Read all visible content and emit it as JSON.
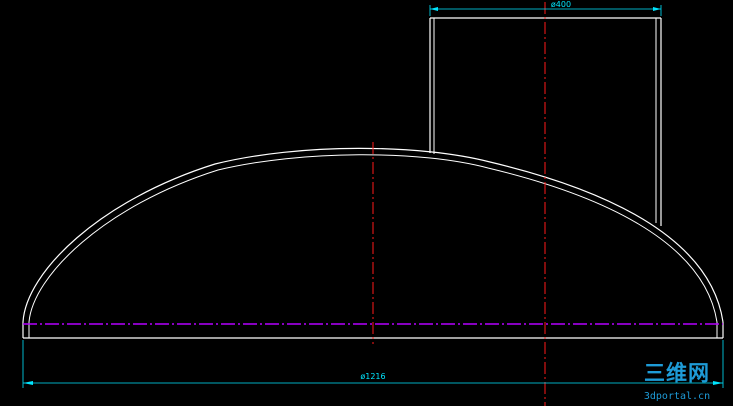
{
  "drawing": {
    "colors": {
      "background": "#000000",
      "outline": "#ffffff",
      "centerline": "#ff1a1a",
      "dimension": "#00e5ff",
      "base_line": "#b400ff",
      "watermark": "#1e9bd7"
    },
    "dimensions": {
      "nozzle_diameter": "ø400",
      "head_diameter": "ø1216"
    },
    "watermark": {
      "main": "三维网",
      "sub": "3dportal.cn"
    }
  }
}
